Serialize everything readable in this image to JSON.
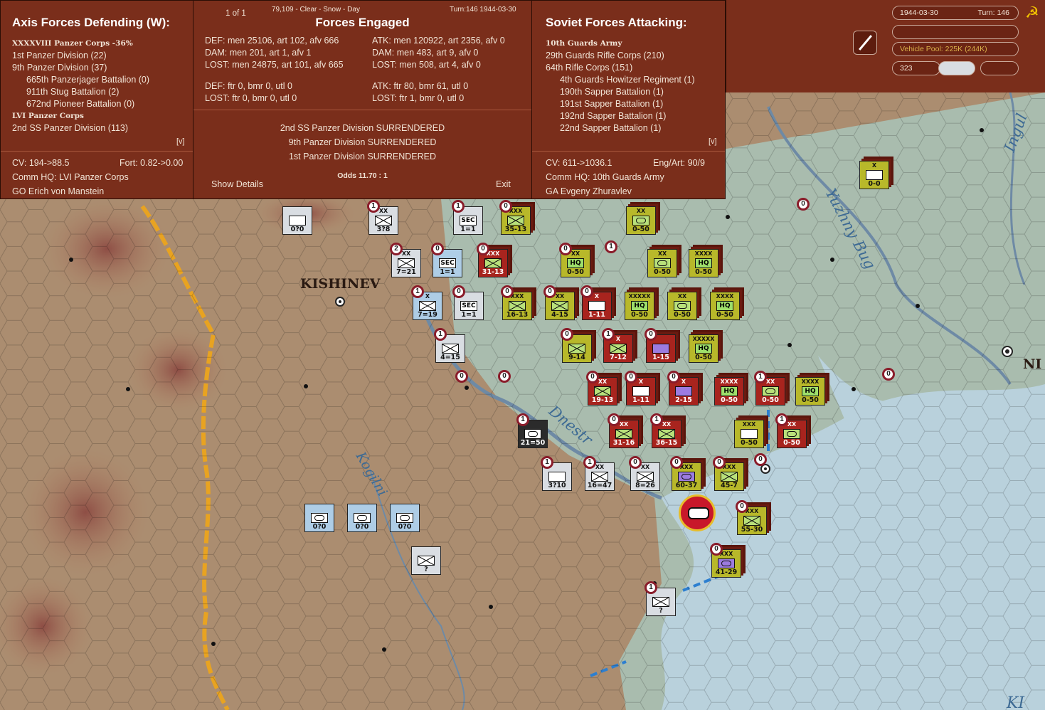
{
  "top_info": {
    "page": "1 of 1",
    "conditions": "79,109 - Clear - Snow - Day",
    "turn_date": "Turn:146  1944-03-30"
  },
  "axis": {
    "title": "Axis Forces Defending (W):",
    "units": [
      {
        "text": "XXXXVIII Panzer Corps  -36%",
        "bold": true,
        "indent": 0
      },
      {
        "text": "1st Panzer Division (22)",
        "bold": false,
        "indent": 0
      },
      {
        "text": "9th Panzer Division (37)",
        "bold": false,
        "indent": 0
      },
      {
        "text": "665th Panzerjager Battalion (0)",
        "bold": false,
        "indent": 1
      },
      {
        "text": "911th Stug Battalion (2)",
        "bold": false,
        "indent": 1
      },
      {
        "text": "672nd Pioneer Battalion (0)",
        "bold": false,
        "indent": 1
      },
      {
        "text": "LVI Panzer Corps",
        "bold": true,
        "indent": 0
      },
      {
        "text": "2nd SS Panzer Division (113)",
        "bold": false,
        "indent": 0
      }
    ],
    "expand": "[v]",
    "cv": "CV: 194->88.5",
    "fort": "Fort: 0.82->0.00",
    "hq": "Comm HQ: LVI Panzer Corps",
    "leader": "GO Erich von Manstein"
  },
  "engaged": {
    "title": "Forces Engaged",
    "def_lines": [
      "DEF: men 25106, art 102, afv 666",
      "DAM: men 201, art 1, afv 1",
      "LOST: men 24875, art 101, afv 665"
    ],
    "def_air": [
      "DEF: ftr 0, bmr 0, utl 0",
      "LOST: ftr 0, bmr 0, utl 0"
    ],
    "atk_lines": [
      "ATK: men 120922, art 2356, afv 0",
      "DAM: men 483, art 9, afv 0",
      "LOST: men 508, art 4, afv 0"
    ],
    "atk_air": [
      "ATK: ftr 80, bmr 61, utl 0",
      "LOST: ftr 1, bmr 0, utl 0"
    ],
    "results": [
      "2nd SS Panzer Division SURRENDERED",
      "9th Panzer Division SURRENDERED",
      "1st Panzer Division SURRENDERED"
    ],
    "odds": "Odds 11.70 : 1",
    "show_details": "Show Details",
    "exit": "Exit"
  },
  "soviet": {
    "title": "Soviet Forces Attacking:",
    "units": [
      {
        "text": "10th Guards Army",
        "bold": true,
        "indent": 0
      },
      {
        "text": "29th Guards Rifle Corps (210)",
        "bold": false,
        "indent": 0
      },
      {
        "text": "64th Rifle Corps (151)",
        "bold": false,
        "indent": 0
      },
      {
        "text": "4th Guards Howitzer Regiment (1)",
        "bold": false,
        "indent": 1
      },
      {
        "text": "190th Sapper Battalion (1)",
        "bold": false,
        "indent": 1
      },
      {
        "text": "191st Sapper Battalion (1)",
        "bold": false,
        "indent": 1
      },
      {
        "text": "192nd Sapper Battalion (1)",
        "bold": false,
        "indent": 1
      },
      {
        "text": "22nd Sapper Battalion (1)",
        "bold": false,
        "indent": 1
      }
    ],
    "expand": "[v]",
    "cv": "CV: 611->1036.1",
    "engart": "Eng/Art: 90/9",
    "hq": "Comm HQ: 10th Guards Army",
    "leader": "GA Evgeny Zhuravlev"
  },
  "status": {
    "date": "1944-03-30",
    "turn": "Turn: 146",
    "vehicle_pool": "Vehicle Pool: 225K (244K)",
    "counter": "323"
  },
  "map_labels": {
    "city1": "KISHINEV",
    "city2": "NI",
    "river1": "Dnestr",
    "river2": "Kogilni",
    "river3": "Yuzhny Bug",
    "river4": "Ingul",
    "river5": "KI"
  },
  "colors": {
    "panel": "#7a2e1b",
    "soviet_unit": "#b8b82a",
    "soviet_red": "#a8241e",
    "axis_unit": "#d9dde2",
    "axis_blue": "#aecde6"
  },
  "units": [
    {
      "cls": "axis",
      "ech": "",
      "str": "0?0",
      "sym": "r",
      "pip": ""
    },
    {
      "cls": "axis",
      "ech": "XX",
      "str": "3?8",
      "sym": "inf",
      "pip": "1"
    },
    {
      "cls": "axis",
      "ech": "",
      "str": "1=1",
      "sym": "SEC",
      "pip": "1"
    },
    {
      "cls": "sov",
      "ech": "XXX",
      "str": "35-13",
      "sym": "inf",
      "pip": "0"
    },
    {
      "cls": "sovp",
      "ech": "XX",
      "str": "0-50",
      "sym": "cav",
      "pip": ""
    },
    {
      "cls": "axis",
      "ech": "XX",
      "str": "7=21",
      "sym": "inf",
      "pip": "2"
    },
    {
      "cls": "blue",
      "ech": "",
      "str": "1=1",
      "sym": "SEC",
      "pip": "0"
    },
    {
      "cls": "red",
      "ech": "XXX",
      "str": "31-13",
      "sym": "inf",
      "pip": "0"
    },
    {
      "cls": "sov",
      "ech": "XX",
      "str": "0-50",
      "sym": "HQ",
      "pip": "0"
    },
    {
      "cls": "sov",
      "ech": "XX",
      "str": "0-50",
      "sym": "cav",
      "pip": ""
    },
    {
      "cls": "sov",
      "ech": "XXXX",
      "str": "0-50",
      "sym": "HQ",
      "pip": ""
    },
    {
      "cls": "blue",
      "ech": "X",
      "str": "7=19",
      "sym": "inf",
      "pip": "1"
    },
    {
      "cls": "axis",
      "ech": "",
      "str": "1=1",
      "sym": "SEC",
      "pip": "0"
    },
    {
      "cls": "sov",
      "ech": "XXX",
      "str": "16-13",
      "sym": "inf",
      "pip": "0"
    },
    {
      "cls": "sov",
      "ech": "XX",
      "str": "4-15",
      "sym": "inf",
      "pip": "0"
    },
    {
      "cls": "red",
      "ech": "X",
      "str": "1-11",
      "sym": "art",
      "pip": "0"
    },
    {
      "cls": "sov",
      "ech": "XXXXX",
      "str": "0-50",
      "sym": "HQ",
      "pip": ""
    },
    {
      "cls": "sov",
      "ech": "XX",
      "str": "0-50",
      "sym": "cav",
      "pip": ""
    },
    {
      "cls": "sov",
      "ech": "XXXX",
      "str": "0-50",
      "sym": "HQ",
      "pip": ""
    },
    {
      "cls": "axis",
      "ech": "",
      "str": "4=15",
      "sym": "inf",
      "pip": "1"
    },
    {
      "cls": "sov",
      "ech": "",
      "str": "9-14",
      "sym": "inf",
      "pip": "0"
    },
    {
      "cls": "red",
      "ech": "X",
      "str": "7-12",
      "sym": "inf",
      "pip": "1"
    },
    {
      "cls": "red",
      "ech": "",
      "str": "1-15",
      "sym": "eng",
      "pip": "0"
    },
    {
      "cls": "sov",
      "ech": "XXXXX",
      "str": "0-50",
      "sym": "HQ",
      "pip": ""
    },
    {
      "cls": "red",
      "ech": "XX",
      "str": "19-13",
      "sym": "inf",
      "pip": "0"
    },
    {
      "cls": "red",
      "ech": "X",
      "str": "1-11",
      "sym": "art",
      "pip": "0"
    },
    {
      "cls": "red",
      "ech": "X",
      "str": "2-15",
      "sym": "eng",
      "pip": "0"
    },
    {
      "cls": "red",
      "ech": "XXXX",
      "str": "0-50",
      "sym": "HQ",
      "pip": ""
    },
    {
      "cls": "red",
      "ech": "XX",
      "str": "0-50",
      "sym": "cav",
      "pip": "1"
    },
    {
      "cls": "sov",
      "ech": "XXXX",
      "str": "0-50",
      "sym": "HQ",
      "pip": ""
    },
    {
      "cls": "dark",
      "ech": "",
      "str": "21=50",
      "sym": "arm",
      "pip": "1"
    },
    {
      "cls": "red",
      "ech": "XX",
      "str": "31-16",
      "sym": "inf",
      "pip": "0"
    },
    {
      "cls": "red",
      "ech": "XX",
      "str": "36-15",
      "sym": "inf",
      "pip": "1"
    },
    {
      "cls": "sov",
      "ech": "XXX",
      "str": "0-50",
      "sym": "para",
      "pip": ""
    },
    {
      "cls": "red",
      "ech": "XX",
      "str": "0-50",
      "sym": "cav",
      "pip": "1"
    },
    {
      "cls": "axis",
      "ech": "",
      "str": "3?10",
      "sym": "blank",
      "pip": "1"
    },
    {
      "cls": "axis",
      "ech": "XX",
      "str": "16=47",
      "sym": "inf",
      "pip": "1"
    },
    {
      "cls": "axis",
      "ech": "XX",
      "str": "8=26",
      "sym": "inf",
      "pip": "0"
    },
    {
      "cls": "sov",
      "ech": "XXX",
      "str": "60-37",
      "sym": "arm",
      "pip": "0"
    },
    {
      "cls": "sov",
      "ech": "XXX",
      "str": "45-7",
      "sym": "inf",
      "pip": "0"
    },
    {
      "cls": "sov",
      "ech": "XXX",
      "str": "55-30",
      "sym": "inf",
      "pip": "0"
    },
    {
      "cls": "sov",
      "ech": "XXX",
      "str": "41-29",
      "sym": "arm",
      "pip": "0"
    },
    {
      "cls": "blue",
      "ech": "",
      "str": "0?0",
      "sym": "cav",
      "pip": ""
    },
    {
      "cls": "blue",
      "ech": "",
      "str": "0?0",
      "sym": "cav",
      "pip": ""
    },
    {
      "cls": "blue",
      "ech": "",
      "str": "0?0",
      "sym": "cav",
      "pip": ""
    },
    {
      "cls": "axis",
      "ech": "",
      "str": "?",
      "sym": "inf",
      "pip": ""
    },
    {
      "cls": "axis",
      "ech": "",
      "str": "?",
      "sym": "inf",
      "pip": "1"
    },
    {
      "cls": "sov",
      "ech": "X",
      "str": "0-0",
      "sym": "para",
      "pip": ""
    }
  ],
  "loose_pips": [
    "0",
    "1",
    "0",
    "0",
    "0",
    "0"
  ]
}
